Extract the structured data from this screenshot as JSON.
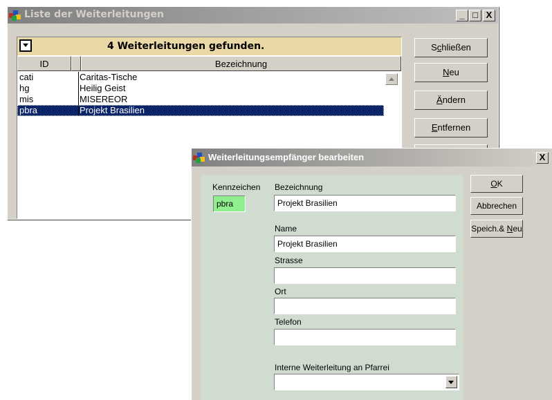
{
  "list_window": {
    "title": "Liste der Weiterleitungen",
    "found_text": "4 Weiterleitungen gefunden.",
    "columns": [
      "ID",
      "Bezeichnung"
    ],
    "rows": [
      {
        "id": "cati",
        "name": "Caritas-Tische"
      },
      {
        "id": "hg",
        "name": "Heilig Geist"
      },
      {
        "id": "mis",
        "name": "MISEREOR"
      },
      {
        "id": "pbra",
        "name": "Projekt Brasilien"
      }
    ],
    "selected_row": "pbra",
    "buttons": {
      "close": {
        "pre": "S",
        "u": "c",
        "post": "hließen"
      },
      "new": {
        "pre": "",
        "u": "N",
        "post": "eu"
      },
      "edit": {
        "pre": "",
        "u": "Ä",
        "post": "ndern"
      },
      "remove": {
        "pre": "",
        "u": "E",
        "post": "ntfernen"
      }
    },
    "controls": {
      "minimize": "_",
      "maximize": "□",
      "close": "X"
    }
  },
  "dialog": {
    "title": "Weiterleitungsempfänger bearbeiten",
    "close_glyph": "X",
    "labels": {
      "kennzeichen": "Kennzeichen",
      "bezeichnung": "Bezeichnung",
      "name": "Name",
      "strasse": "Strasse",
      "ort": "Ort",
      "telefon": "Telefon",
      "pfarrei": "Interne Weiterleitung an Pfarrei"
    },
    "values": {
      "kennzeichen": "pbra",
      "bezeichnung": "Projekt Brasilien",
      "name": "Projekt Brasilien",
      "strasse": "",
      "ort": "",
      "telefon": "",
      "pfarrei": ""
    },
    "buttons": {
      "ok": {
        "pre": "",
        "u": "O",
        "post": "K"
      },
      "cancel": {
        "pre": "Abbrechen",
        "u": "",
        "post": ""
      },
      "save_new": {
        "pre": "Speich.& ",
        "u": "N",
        "post": "eu"
      }
    }
  },
  "colors": {
    "found_bar": "#ead8a6",
    "selection": "#0a246a",
    "dialog_form": "#d0dcd0",
    "kennzeichen_field": "#90f090"
  },
  "icons": [
    "app-icon",
    "dropdown-arrow-icon",
    "scroll-up-arrow-icon",
    "combo-arrow-icon"
  ]
}
